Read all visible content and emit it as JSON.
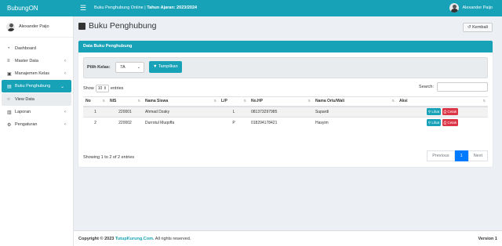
{
  "app": {
    "brand": "BubungON"
  },
  "navbar": {
    "title_prefix": "Buku Penghubung Online | ",
    "title_year": "Tahun Ajaran: 2023/2024",
    "user_name": "Alexander Paijo"
  },
  "sidebar": {
    "user_name": "Alexander Paijo",
    "items": [
      {
        "label": "Dashboard",
        "icon": "dashboard-icon"
      },
      {
        "label": "Master Data",
        "icon": "database-icon"
      },
      {
        "label": "Manajemen Kelas",
        "icon": "users-icon"
      },
      {
        "label": "Buku Penghubung",
        "icon": "file-icon"
      },
      {
        "label": "View Data",
        "icon": "circle-icon"
      },
      {
        "label": "Laporan",
        "icon": "report-icon"
      },
      {
        "label": "Pengaturan",
        "icon": "gear-icon"
      }
    ]
  },
  "page": {
    "title": "Buku Penghubung",
    "back_label": "Kembali"
  },
  "card": {
    "header": "Data Buku Penghubung",
    "filter_label": "Pilih Kelas:",
    "filter_value": "7A",
    "show_button": "Tampilkan"
  },
  "table_controls": {
    "show": "Show",
    "entries_value": "10",
    "entries": "entries",
    "search_label": "Search:"
  },
  "table": {
    "columns": [
      "No",
      "NIS",
      "Nama Siswa",
      "L/P",
      "No.HP",
      "Nama Ortu/Wali",
      "Aksi"
    ],
    "rows": [
      {
        "no": "1",
        "nis": "220001",
        "nama": "Ahmad Dzaky",
        "lp": "L",
        "hp": "081373297985",
        "ortu": "Supardi",
        "btn_view": "Lihat",
        "btn_print": "Cetak"
      },
      {
        "no": "2",
        "nis": "220002",
        "nama": "Durrotul Muqoffa",
        "lp": "P",
        "hp": "018294178421",
        "ortu": "Hasyim",
        "btn_view": "Lihat",
        "btn_print": "Cetak"
      }
    ]
  },
  "table_info": "Showing 1 to 2 of 2 entries",
  "pagination": {
    "previous": "Previous",
    "current": "1",
    "next": "Next"
  },
  "footer": {
    "copyright_prefix": "Copyright © 2023 ",
    "copyright_brand": "TutupKurung.Com.",
    "copyright_suffix": " All rights reserved.",
    "version": "Version 1"
  },
  "colors": {
    "accent": "#17a2b8",
    "danger": "#dc3545",
    "primary": "#007bff"
  }
}
